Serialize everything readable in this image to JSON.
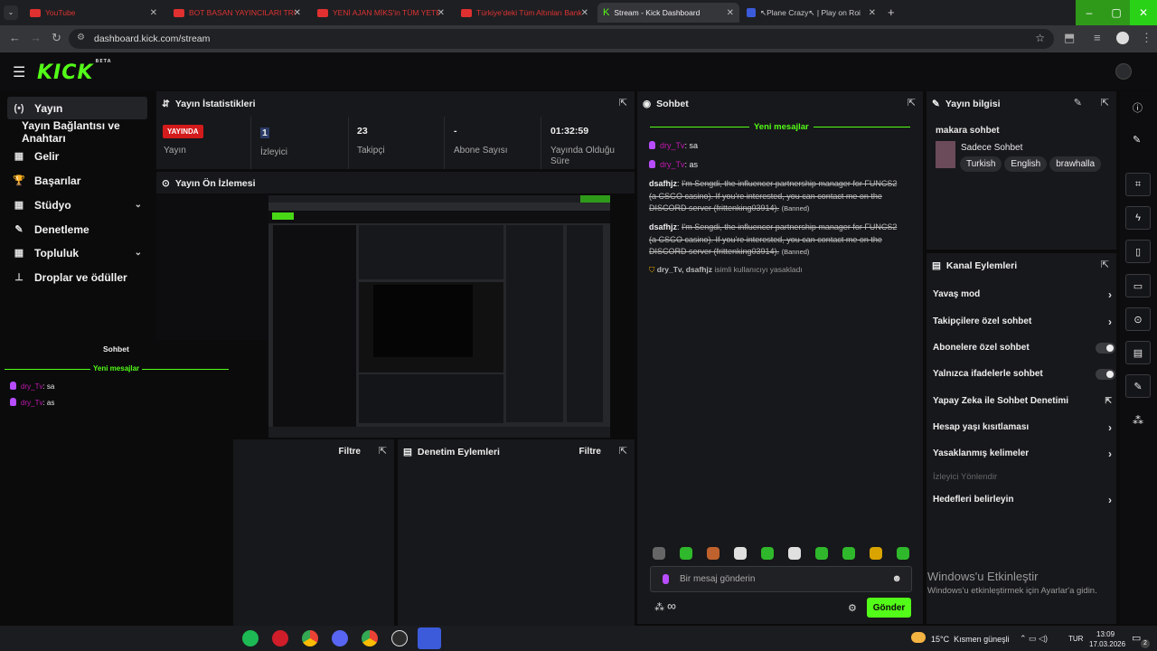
{
  "browser": {
    "tabs": [
      {
        "label": "YouTube"
      },
      {
        "label": "BOT BASAN YAYINCILARI TROL"
      },
      {
        "label": "YENİ AJAN MİKS'in TÜM YETEN"
      },
      {
        "label": "Türkiye'deki Tüm Altınları Bank"
      },
      {
        "label": "Stream - Kick Dashboard"
      },
      {
        "label": "↖Plane Crazy↖ | Play on Roi"
      }
    ],
    "url": "dashboard.kick.com/stream"
  },
  "logo": {
    "text": "KICK",
    "badge": "BETA"
  },
  "sidebar": {
    "items": [
      {
        "label": "Yayın",
        "icon": "(•)"
      },
      {
        "label": "Yayın Bağlantısı ve Anahtarı",
        "icon": ""
      },
      {
        "label": "Gelir",
        "icon": "▦"
      },
      {
        "label": "Başarılar",
        "icon": "🏆"
      },
      {
        "label": "Stüdyo",
        "icon": "▦"
      },
      {
        "label": "Denetleme",
        "icon": "✎"
      },
      {
        "label": "Topluluk",
        "icon": "▦"
      },
      {
        "label": "Droplar ve ödüller",
        "icon": "⊥"
      }
    ]
  },
  "stats": {
    "title": "Yayın İstatistikleri",
    "live_badge": "YAYINDA",
    "items": [
      {
        "value": "",
        "label": "Yayın"
      },
      {
        "value": "1",
        "label": "İzleyici"
      },
      {
        "value": "23",
        "label": "Takipçi"
      },
      {
        "value": "-",
        "label": "Abone Sayısı"
      },
      {
        "value": "01:32:59",
        "label": "Yayında Olduğu Süre"
      }
    ]
  },
  "preview": {
    "title": "Yayın Ön İzlemesi"
  },
  "mini_chat": {
    "title": "Sohbet",
    "new_messages": "Yeni mesajlar",
    "messages": [
      {
        "user": "dry_Tv",
        "text": "sa"
      },
      {
        "user": "dry_Tv",
        "text": "as"
      }
    ]
  },
  "bottom_panels": {
    "filter_label": "Filtre",
    "moderation_title": "Denetim Eylemleri"
  },
  "chat": {
    "title": "Sohbet",
    "new_messages": "Yeni mesajlar",
    "messages": [
      {
        "user": "dry_Tv",
        "text": "sa"
      },
      {
        "user": "dry_Tv",
        "text": "as"
      }
    ],
    "spam": [
      {
        "user": "dsafhjz",
        "text": "I'm Sengdi, the influencer partnership manager for FUNCS2 (a CSGO casino). If you're interested, you can contact me on the DISCORD server (frittenking03914).",
        "tag": "(Banned)"
      },
      {
        "user": "dsafhjz",
        "text": "I'm Sengdi, the influencer partnership manager for FUNCS2 (a CSGO casino). If you're interested, you can contact me on the DISCORD server (frittenking03914).",
        "tag": "(Banned)"
      }
    ],
    "ban_notice_actor": "dry_Tv,",
    "ban_notice_target": "dsafhjz",
    "ban_notice_text": "isimli kullanıcıyı yasakladı",
    "input_placeholder": "Bir mesaj gönderin",
    "send_label": "Gönder",
    "infinity": "∞"
  },
  "stream_info": {
    "title": "Yayın bilgisi",
    "stream_title": "makara sohbet",
    "category": "Sadece Sohbet",
    "tags": [
      "Turkish",
      "English",
      "brawhalla"
    ]
  },
  "channel_actions": {
    "title": "Kanal Eylemleri",
    "items": [
      {
        "label": "Yavaş mod",
        "type": "arrow"
      },
      {
        "label": "Takipçilere özel sohbet",
        "type": "arrow"
      },
      {
        "label": "Abonelere özel sohbet",
        "type": "toggle"
      },
      {
        "label": "Yalnızca ifadelerle sohbet",
        "type": "toggle"
      },
      {
        "label": "Yapay Zeka ile Sohbet Denetimi",
        "type": "external"
      },
      {
        "label": "Hesap yaşı kısıtlaması",
        "type": "arrow"
      },
      {
        "label": "Yasaklanmış kelimeler",
        "type": "arrow"
      },
      {
        "label": "İzleyici Yönlendir",
        "type": "disabled"
      },
      {
        "label": "Hedefleri belirleyin",
        "type": "arrow"
      }
    ]
  },
  "watermark": {
    "title": "Windows'u Etkinleştir",
    "subtitle": "Windows'u etkinleştirmek için Ayarlar'a gidin."
  },
  "taskbar": {
    "weather": "15°C  Kısmen güneşli",
    "lang": "TUR",
    "time": "13:09",
    "date": "17.03.2026",
    "notif": "2"
  },
  "colors": {
    "accent": "#53fc18",
    "live": "#d31b1b",
    "username": "#c01ab0"
  }
}
